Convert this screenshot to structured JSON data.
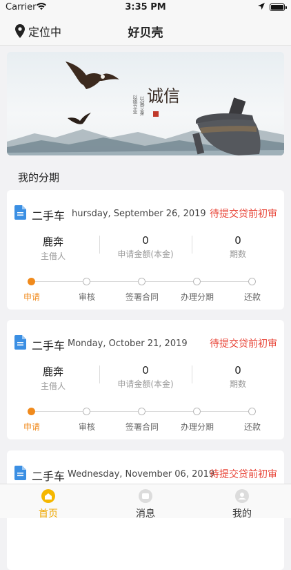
{
  "status_bar": {
    "carrier": "Carrier",
    "time": "3:35 PM"
  },
  "nav": {
    "location_label": "定位中",
    "title": "好贝壳"
  },
  "banner": {
    "calligraphy": "诚信",
    "left_lines": [
      "以德立业",
      "以诚立身"
    ]
  },
  "section_title": "我的分期",
  "cards": [
    {
      "category": "二手车",
      "date": "hursday, September 26, 2019",
      "status": "待提交贷前初审",
      "borrower_value": "鹿奔",
      "borrower_label": "主借人",
      "amount_value": "0",
      "amount_label": "申请金额(本金)",
      "periods_value": "0",
      "periods_label": "期数"
    },
    {
      "category": "二手车",
      "date": "Monday, October 21, 2019",
      "status": "待提交贷前初审",
      "borrower_value": "鹿奔",
      "borrower_label": "主借人",
      "amount_value": "0",
      "amount_label": "申请金额(本金)",
      "periods_value": "0",
      "periods_label": "期数"
    },
    {
      "category": "二手车",
      "date": "Wednesday, November 06, 2019",
      "status": "待提交贷前初审"
    }
  ],
  "steps": [
    "申请",
    "审核",
    "签署合同",
    "办理分期",
    "还款"
  ],
  "tabs": [
    {
      "label": "首页",
      "active": true
    },
    {
      "label": "消息",
      "active": false
    },
    {
      "label": "我的",
      "active": false
    }
  ],
  "colors": {
    "accent_orange": "#f08a1c",
    "status_red": "#e84437",
    "tab_active": "#f0a800",
    "doc_icon_blue": "#3b8fe3"
  }
}
